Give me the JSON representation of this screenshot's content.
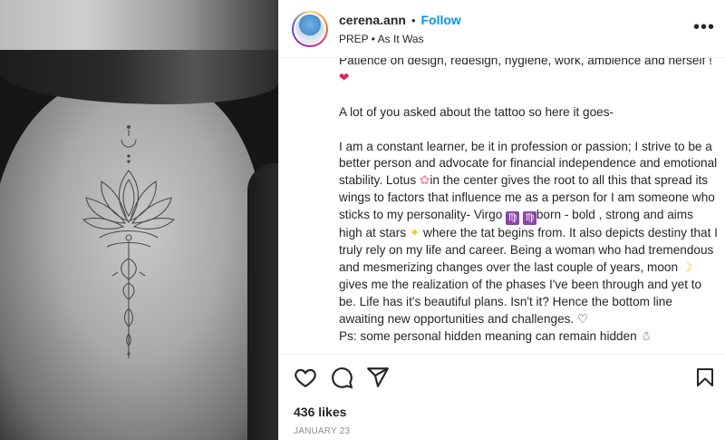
{
  "post": {
    "image_alt": "Black and white photo of a woman's back with a lotus spine tattoo",
    "header": {
      "username": "cerena.ann",
      "separator": "•",
      "follow_label": "Follow",
      "subtitle": "PREP • As It Was",
      "more_icon": "more-options-icon"
    },
    "caption": {
      "line1_text": "Patience on design, redesign, hygiene, work, ambience and herself !",
      "line1_emoji": "❤",
      "line2": "A lot of you asked about the tattoo so here it goes-",
      "p3_a": "I am a constant learner, be it in profession or passion; I strive to be a better person and advocate for financial independence and emotional stability. Lotus",
      "emoji_lotus": "✿",
      "p3_b": "in the center gives the root to all this that spread its wings to factors that influence me as a person for I am someone who sticks to my personality- Virgo",
      "emoji_virgo": "♍",
      "p3_c": "born - bold , strong and aims high at stars",
      "emoji_stars": "✦",
      "p3_d": "where the tat begins from. It also depicts destiny that I truly rely on my life and career. Being a woman who had tremendous and mesmerizing changes over the last couple of years, moon",
      "emoji_moon": "☽",
      "p3_e": "gives me the realization of the phases I've been through and yet to be. Life has it's beautiful plans. Isn't it? Hence the bottom line awaiting new opportunities and challenges.",
      "emoji_heart_outline": "♡",
      "ps_text": "Ps: some personal hidden meaning can remain hidden",
      "emoji_snowman": "☃"
    },
    "actions": {
      "like_icon": "heart-icon",
      "comment_icon": "comment-icon",
      "share_icon": "share-icon",
      "save_icon": "bookmark-icon"
    },
    "likes": "436 likes",
    "date": "JANUARY 23"
  }
}
